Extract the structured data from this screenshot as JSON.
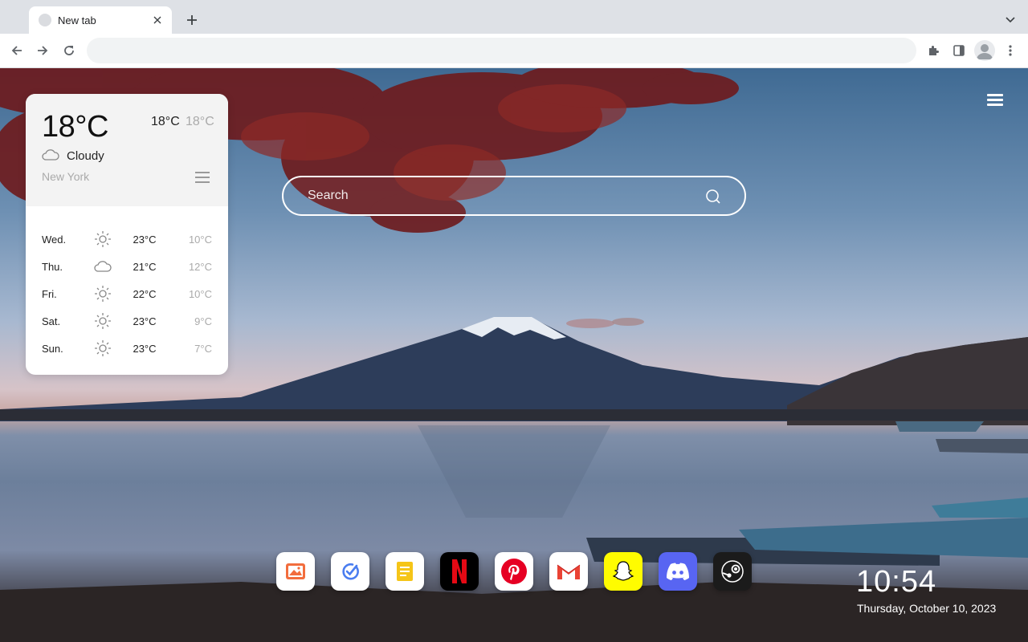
{
  "browser": {
    "tab_title": "New tab",
    "icons": {
      "close": "close-icon",
      "new_tab": "plus-icon",
      "tab_search": "chevron-down-icon",
      "back": "arrow-left-icon",
      "forward": "arrow-right-icon",
      "reload": "reload-icon",
      "extensions": "puzzle-icon",
      "side_panel": "side-panel-icon",
      "profile": "avatar-icon",
      "menu": "kebab-menu-icon"
    },
    "address_value": ""
  },
  "weather": {
    "current_temp": "18°C",
    "high": "18°C",
    "low": "18°C",
    "condition": "Cloudy",
    "condition_icon": "cloud-icon",
    "city": "New York",
    "forecast": [
      {
        "day": "Wed.",
        "icon": "sun-icon",
        "high": "23°C",
        "low": "10°C"
      },
      {
        "day": "Thu.",
        "icon": "cloud-icon",
        "high": "21°C",
        "low": "12°C"
      },
      {
        "day": "Fri.",
        "icon": "sun-icon",
        "high": "22°C",
        "low": "10°C"
      },
      {
        "day": "Sat.",
        "icon": "sun-icon",
        "high": "23°C",
        "low": "9°C"
      },
      {
        "day": "Sun.",
        "icon": "sun-icon",
        "high": "23°C",
        "low": "7°C"
      }
    ]
  },
  "search": {
    "placeholder": "Search",
    "icon": "search-icon"
  },
  "dock": {
    "apps": [
      {
        "name": "photos",
        "icon": "photos-icon",
        "bg": "#ffffff"
      },
      {
        "name": "tasks",
        "icon": "check-icon",
        "bg": "#ffffff"
      },
      {
        "name": "notes",
        "icon": "notes-icon",
        "bg": "#ffffff"
      },
      {
        "name": "netflix",
        "icon": "netflix-icon",
        "bg": "#000000"
      },
      {
        "name": "pinterest",
        "icon": "pinterest-icon",
        "bg": "#ffffff"
      },
      {
        "name": "gmail",
        "icon": "gmail-icon",
        "bg": "#ffffff"
      },
      {
        "name": "snapchat",
        "icon": "snapchat-icon",
        "bg": "#fffc00"
      },
      {
        "name": "discord",
        "icon": "discord-icon",
        "bg": "#5865f2"
      },
      {
        "name": "steam",
        "icon": "steam-icon",
        "bg": "#1b1b1b"
      }
    ]
  },
  "clock": {
    "time": "10:54",
    "date": "Thursday, October 10, 2023"
  },
  "colors": {
    "accent_red": "#e50914",
    "pinterest_red": "#e60023",
    "discord_blue": "#5865f2",
    "snapchat_yellow": "#fffc00"
  }
}
